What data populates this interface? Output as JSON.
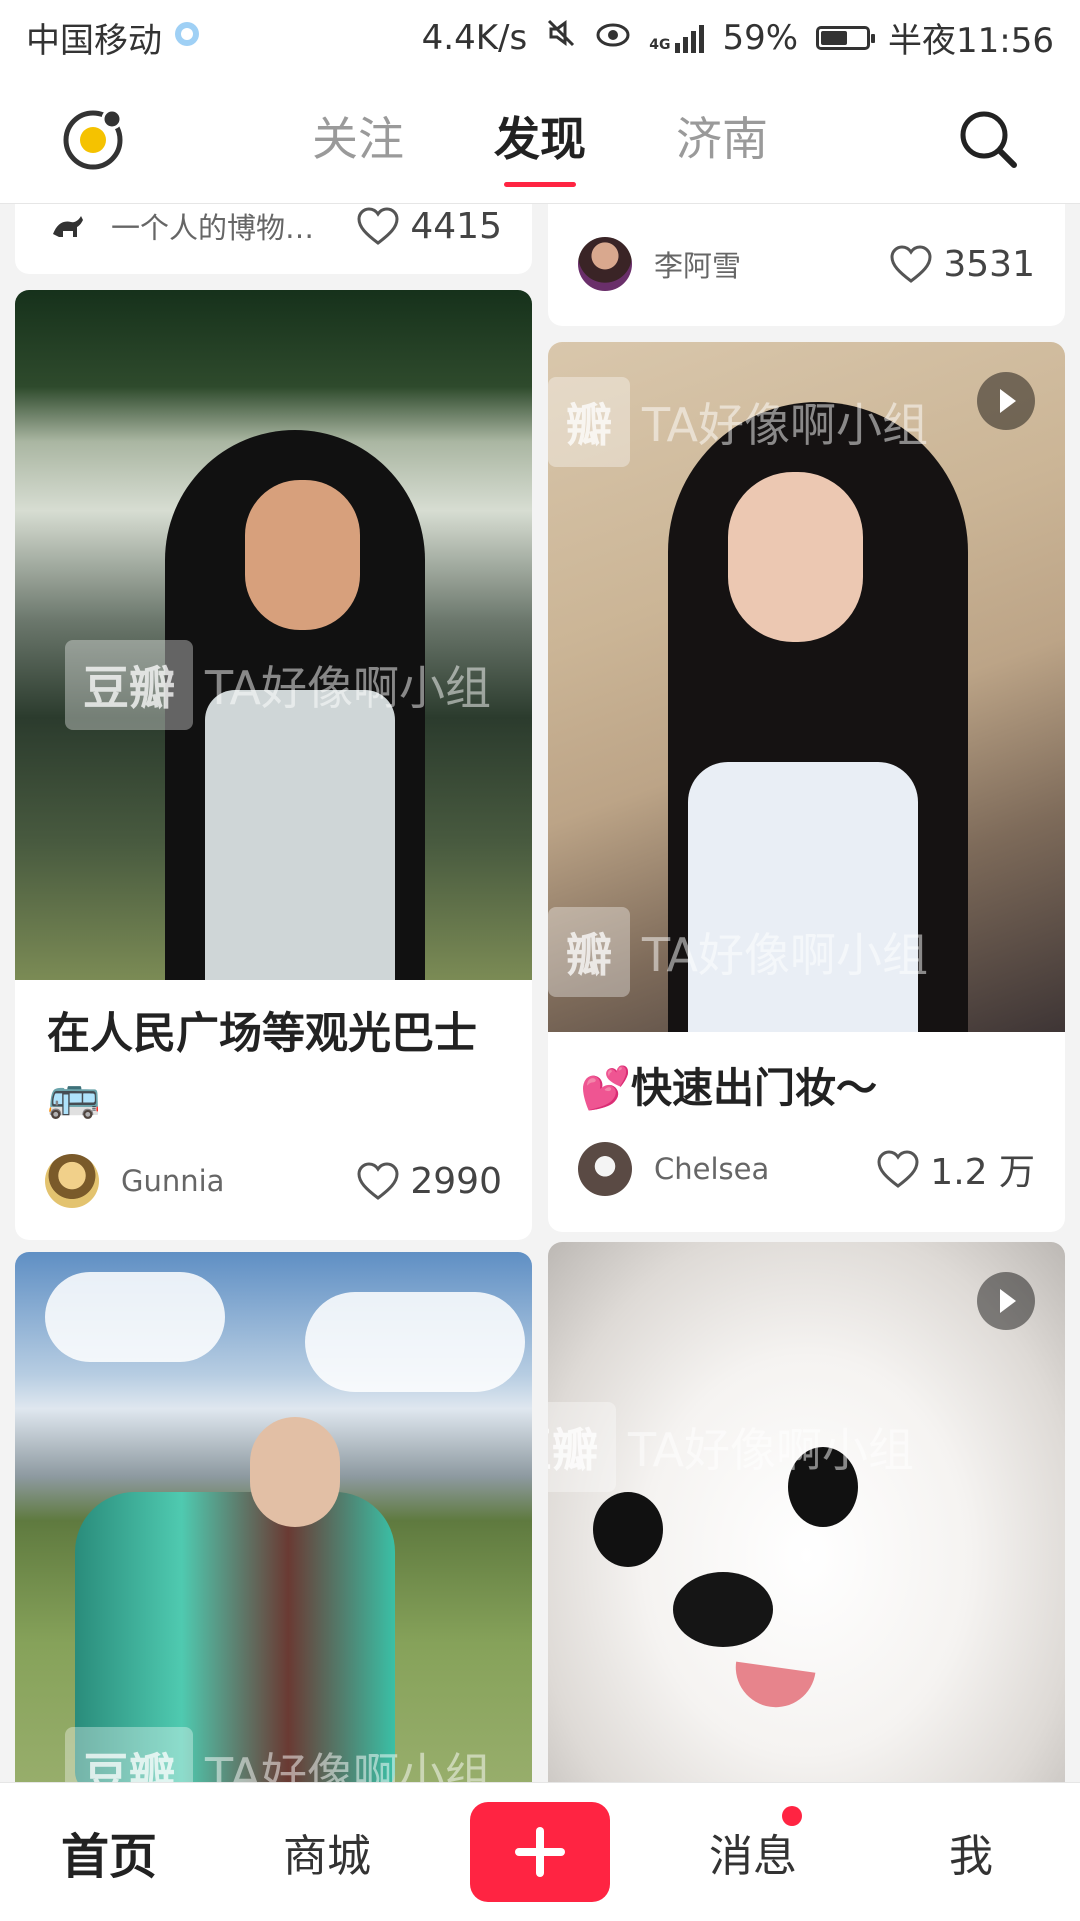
{
  "status_bar": {
    "carrier": "中国移动",
    "speed": "4.4K/s",
    "network": "4G",
    "battery": "59%",
    "battery_level": 0.59,
    "time": "半夜11:56"
  },
  "top_nav": {
    "tabs": [
      {
        "label": "关注",
        "active": false
      },
      {
        "label": "发现",
        "active": true
      },
      {
        "label": "济南",
        "active": false
      }
    ]
  },
  "feed": {
    "watermark_text": "TA好像啊小组",
    "watermark_brand": "豆瓣",
    "cards": [
      {
        "author": "一个人的博物…",
        "likes": "4415"
      },
      {
        "author": "李阿雪",
        "likes": "3531"
      },
      {
        "title": "在人民广场等观光巴士🚌",
        "author": "Gunnia",
        "likes": "2990"
      },
      {
        "title": "💕快速出门妆～",
        "author": "Chelsea",
        "likes": "1.2 万",
        "video": true
      },
      {
        "title": "",
        "author": "",
        "likes": ""
      },
      {
        "title": "",
        "author": "",
        "likes": "",
        "video": true
      }
    ]
  },
  "bottom_bar": {
    "items": [
      {
        "label": "首页",
        "active": true
      },
      {
        "label": "商城",
        "active": false
      },
      {
        "label": "消息",
        "active": false,
        "badge": true
      },
      {
        "label": "我",
        "active": false
      }
    ]
  },
  "colors": {
    "accent": "#ff2442",
    "text": "#222222",
    "muted": "#9a9a9a"
  },
  "icons": [
    "silent-icon",
    "eye-icon",
    "signal-icon",
    "battery-icon",
    "logo-icon",
    "search-icon",
    "heart-icon",
    "play-icon",
    "plus-icon"
  ]
}
